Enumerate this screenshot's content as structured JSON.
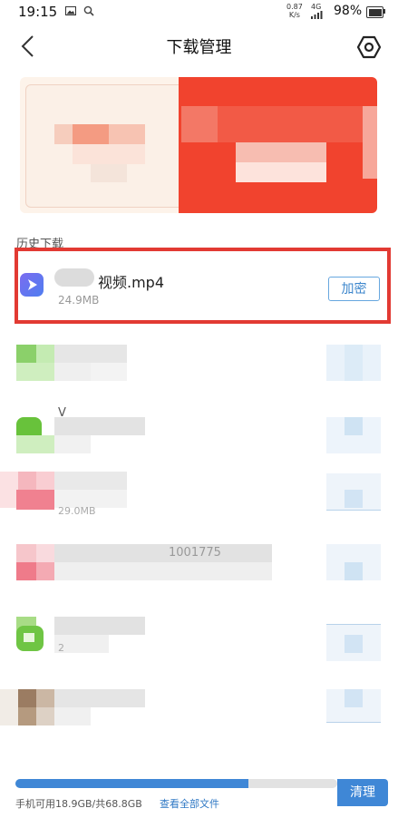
{
  "status_bar": {
    "time": "19:15",
    "net_speed_value": "0.87",
    "net_speed_unit": "K/s",
    "signal": "4G",
    "battery": "98%"
  },
  "header": {
    "title": "下载管理"
  },
  "section": {
    "history_label": "历史下载"
  },
  "download_item": {
    "filename_suffix": "视频.mp4",
    "size": "24.9MB",
    "encrypt_label": "加密"
  },
  "blurred_rows": [
    {
      "visible_text": ""
    },
    {
      "visible_text": "V"
    },
    {
      "visible_text": "29.0MB"
    },
    {
      "visible_text": "1001775"
    },
    {
      "visible_text": "2"
    },
    {
      "visible_text": ""
    }
  ],
  "footer": {
    "storage_text": "手机可用18.9GB/共68.8GB",
    "view_all_label": "查看全部文件",
    "clean_label": "清理",
    "storage_used_fraction": 0.725
  },
  "colors": {
    "accent": "#3f87d6",
    "highlight_border": "#e23a33",
    "banner_red": "#f1432e"
  }
}
